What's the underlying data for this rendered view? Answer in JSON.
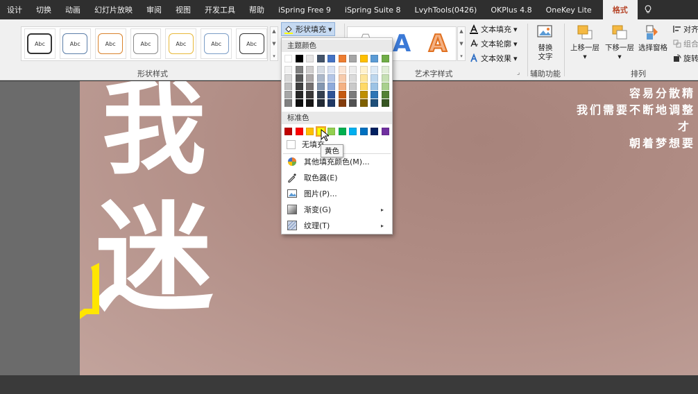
{
  "tabs": [
    {
      "label": "设计"
    },
    {
      "label": "切换"
    },
    {
      "label": "动画"
    },
    {
      "label": "幻灯片放映"
    },
    {
      "label": "审阅"
    },
    {
      "label": "视图"
    },
    {
      "label": "开发工具"
    },
    {
      "label": "帮助"
    },
    {
      "label": "iSpring Free 9"
    },
    {
      "label": "iSpring Suite 8"
    },
    {
      "label": "LvyhTools(0426)"
    },
    {
      "label": "OKPlus 4.8"
    },
    {
      "label": "OneKey Lite"
    },
    {
      "label": "格式"
    }
  ],
  "ribbon": {
    "shape_styles": {
      "label": "形状样式",
      "thumb_text": "Abc",
      "thumbs": [
        "#333333",
        "#5b7ea8",
        "#d9822b",
        "#555555",
        "#e8b838",
        "#7a9cc6",
        "#333333"
      ],
      "fill_button": "形状填充",
      "fill_arrow": "▾"
    },
    "wordart": {
      "label": "艺术字样式",
      "letters": [
        "A",
        "A",
        "A"
      ],
      "text_fill": "文本填充",
      "text_outline": "文本轮廓",
      "text_effects": "文本效果",
      "launcher": "⌟"
    },
    "accessibility": {
      "label": "辅助功能",
      "alt_text_line1": "替换",
      "alt_text_line2": "文字"
    },
    "arrange": {
      "label": "排列",
      "bring_forward": "上移一层",
      "send_backward": "下移一层",
      "selection_pane": "选择窗格",
      "align": "对齐",
      "group": "组合",
      "rotate": "旋转",
      "dropdown_arrow": "▾"
    }
  },
  "dropdown": {
    "theme_colors_heading": "主题颜色",
    "standard_colors_heading": "标准色",
    "theme_top_row": [
      "#ffffff",
      "#000000",
      "#e7e6e6",
      "#44546a",
      "#4472c4",
      "#ed7d31",
      "#a5a5a5",
      "#ffc000",
      "#5b9bd5",
      "#70ad47"
    ],
    "theme_shades": [
      [
        "#f2f2f2",
        "#d9d9d9",
        "#bfbfbf",
        "#a6a6a6",
        "#808080"
      ],
      [
        "#7f7f7f",
        "#595959",
        "#404040",
        "#262626",
        "#0d0d0d"
      ],
      [
        "#d0cece",
        "#aeaaaa",
        "#757171",
        "#3a3838",
        "#171616"
      ],
      [
        "#d6dce4",
        "#adb9ca",
        "#8497b0",
        "#333f4f",
        "#222a35"
      ],
      [
        "#d9e2f3",
        "#b4c6e7",
        "#8eaadb",
        "#2f5496",
        "#1f3864"
      ],
      [
        "#fbe5d5",
        "#f7cbac",
        "#f4b183",
        "#c55a11",
        "#833c0b"
      ],
      [
        "#ededed",
        "#dbdbdb",
        "#c9c9c9",
        "#7b7b7b",
        "#525252"
      ],
      [
        "#fff2cc",
        "#fee599",
        "#ffd966",
        "#bf8f00",
        "#7f6000"
      ],
      [
        "#deebf6",
        "#bdd7ee",
        "#9cc3e5",
        "#2e75b5",
        "#1e4e79"
      ],
      [
        "#e2efd9",
        "#c5e0b3",
        "#a8d08d",
        "#538135",
        "#375623"
      ]
    ],
    "standard_colors": [
      "#c00000",
      "#ff0000",
      "#ffc000",
      "#ffff00",
      "#92d050",
      "#00b050",
      "#00b0f0",
      "#0070c0",
      "#002060",
      "#7030a0"
    ],
    "selected_standard_index": 3,
    "no_fill": "无填充",
    "more_colors": "其他填充颜色(M)...",
    "eyedropper": "取色器(E)",
    "picture": "图片(P)...",
    "gradient": "渐变(G)",
    "texture": "纹理(T)",
    "submenu_arrow": "▸",
    "tooltip": "黄色"
  },
  "slide": {
    "char_1": "我",
    "char_2": "迷",
    "vertical_text_lines": [
      "容易分散精",
      "我们需要不断地调整",
      "才",
      "朝着梦想要"
    ]
  },
  "colors": {
    "accent": "#b7472a",
    "tooltip_selected": "#ffff00"
  }
}
